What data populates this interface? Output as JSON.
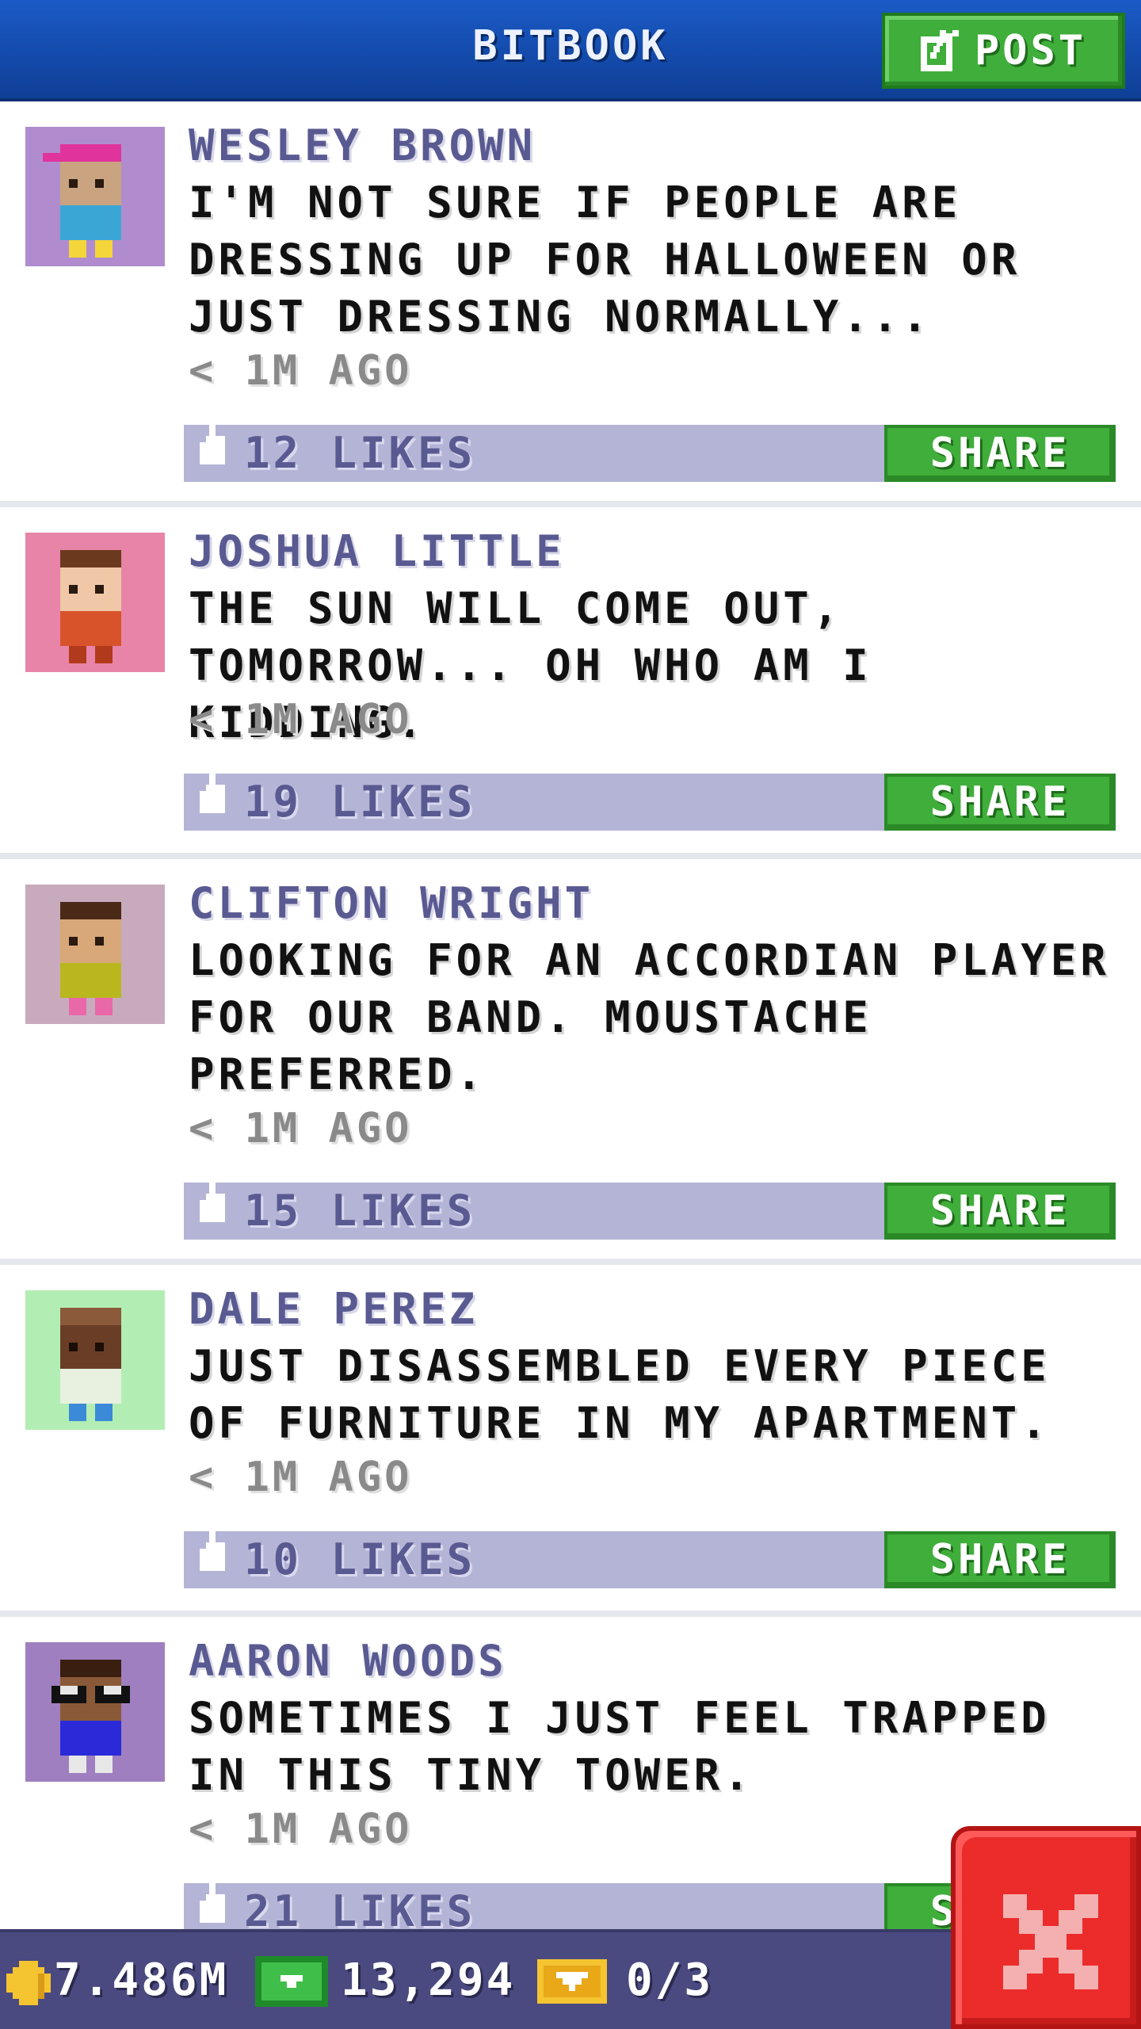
{
  "header": {
    "title": "BITBOOK",
    "post_label": "POST"
  },
  "posts": [
    {
      "author": "WESLEY BROWN",
      "message": "I'M NOT SURE IF PEOPLE ARE DRESSING UP FOR HALLOWEEN OR JUST DRESSING NORMALLY...",
      "time": "< 1M AGO",
      "likes": "12 LIKES",
      "share_label": "SHARE",
      "avatar_bg": "#b08ccf"
    },
    {
      "author": "JOSHUA LITTLE",
      "message": "THE SUN WILL COME OUT, TOMORROW... OH WHO AM I KIDDING.",
      "time": "< 1M AGO",
      "likes": "19 LIKES",
      "share_label": "SHARE",
      "avatar_bg": "#e884a8"
    },
    {
      "author": "CLIFTON WRIGHT",
      "message": "LOOKING FOR AN ACCORDIAN PLAYER FOR OUR BAND. MOUSTACHE PREFERRED.",
      "time": "< 1M AGO",
      "likes": "15 LIKES",
      "share_label": "SHARE",
      "avatar_bg": "#c8aabd"
    },
    {
      "author": "DALE PEREZ",
      "message": "JUST DISASSEMBLED EVERY PIECE OF FURNITURE IN MY APARTMENT.",
      "time": "< 1M AGO",
      "likes": "10 LIKES",
      "share_label": "SHARE",
      "avatar_bg": "#b2eeb4"
    },
    {
      "author": "AARON WOODS",
      "message": "SOMETIMES I JUST FEEL TRAPPED IN THIS TINY TOWER.",
      "time": "< 1M AGO",
      "likes": "21 LIKES",
      "share_label": "SHARE",
      "avatar_bg": "#9f7fbf"
    }
  ],
  "status": {
    "coins": "7.486M",
    "bux": "13,294",
    "tickets": "0/3"
  },
  "icons": {
    "post": "edit-icon",
    "like": "thumbs-up-icon",
    "coins": "coin-icon",
    "bux": "bux-icon",
    "tickets": "ticket-icon",
    "close": "close-icon"
  },
  "colors": {
    "header": "#1b5ac6",
    "accent_green": "#3fae3a",
    "likes_bar": "#b4b4d6",
    "status_bar": "#4a4a80",
    "close_red": "#ec2b2b"
  }
}
